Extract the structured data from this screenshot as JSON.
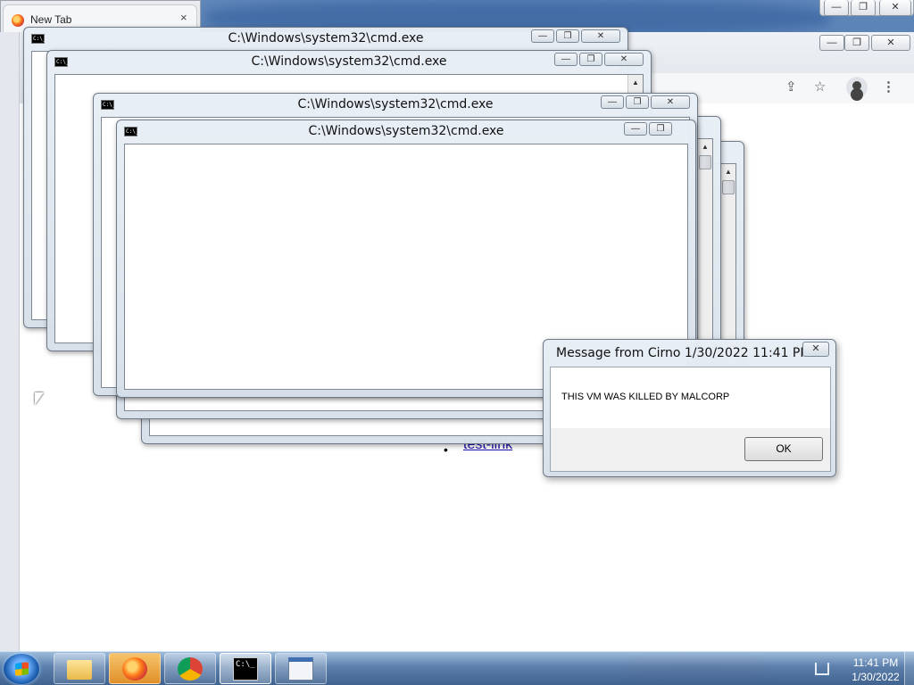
{
  "firefox": {
    "tab_title": "New Tab",
    "tab_close": "×"
  },
  "window_controls": {
    "minimize": "—",
    "maximize": "❐",
    "close": "✕"
  },
  "page": {
    "link_text": "test-link",
    "bullet": "•"
  },
  "cmd_windows": [
    {
      "title": "C:\\Windows\\system32\\cmd.exe"
    },
    {
      "title": "C:\\Windows\\system32\\cmd.exe"
    },
    {
      "title": "C:\\Windows\\system32\\cmd.exe"
    },
    {
      "title": "C:\\Windows\\system32\\cmd.exe"
    }
  ],
  "cmd_icon_text": "C:\\_",
  "message_box": {
    "title": "Message from Cirno 1/30/2022 11:41 PM",
    "body": "THIS VM WAS KILLED BY MALCORP",
    "ok_label": "OK",
    "close_glyph": "✕"
  },
  "toolbar_icons": {
    "share": "⇪",
    "bookmark": "☆",
    "menu": "⋮"
  },
  "taskbar": {
    "buttons": [
      "explorer-icon",
      "firefox-icon",
      "chrome-icon",
      "cmd-icon",
      "app-window-icon"
    ],
    "clock_time": "11:41 PM",
    "clock_date": "1/30/2022"
  },
  "colors": {
    "link": "#1a0dab",
    "taskbar": "#3c5f8c"
  }
}
